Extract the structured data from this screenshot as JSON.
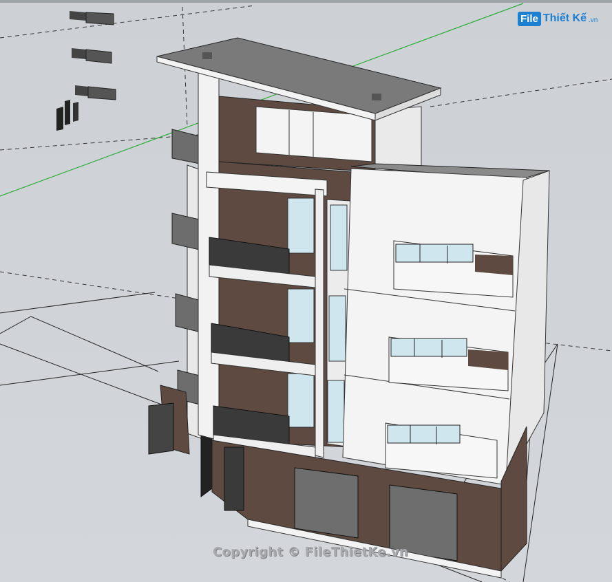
{
  "watermark": {
    "logo_box": "File",
    "logo_text": "Thiết Kế",
    "logo_tld": ".vn",
    "copyright": "Copyright © FileThietKe.vn"
  },
  "colors": {
    "background": "#cfd3d8",
    "wall_white": "#f4f4f4",
    "wall_brown": "#5e4a40",
    "window_glass": "#cfe6ee",
    "green_axis": "#2fae3a",
    "logo_blue": "#1d7fd0"
  }
}
